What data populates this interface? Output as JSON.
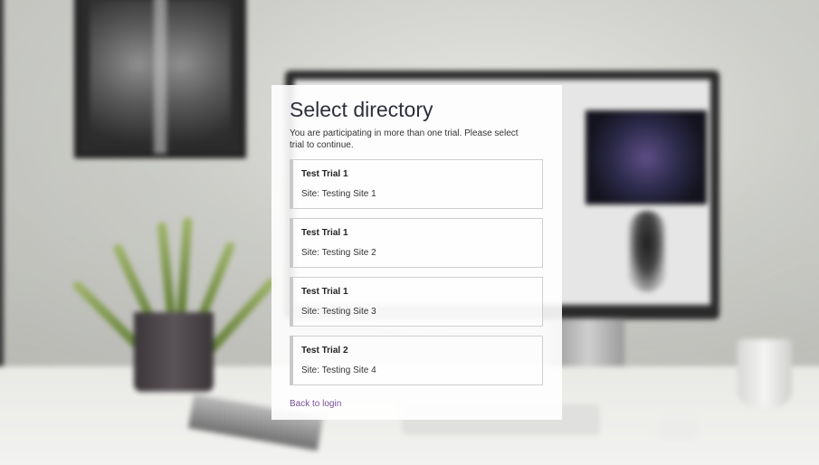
{
  "dialog": {
    "title": "Select directory",
    "subtitle": "You are participating in more than one trial. Please select trial to continue.",
    "trials": [
      {
        "name": "Test Trial 1",
        "site": "Site: Testing Site 1"
      },
      {
        "name": "Test Trial 1",
        "site": "Site: Testing Site 2"
      },
      {
        "name": "Test Trial 1",
        "site": "Site: Testing Site 3"
      },
      {
        "name": "Test Trial 2",
        "site": "Site: Testing Site 4"
      }
    ],
    "back_link": "Back to login"
  },
  "colors": {
    "link": "#7a4f9a",
    "title": "#2d2f3a",
    "card_background": "#ffffff"
  }
}
